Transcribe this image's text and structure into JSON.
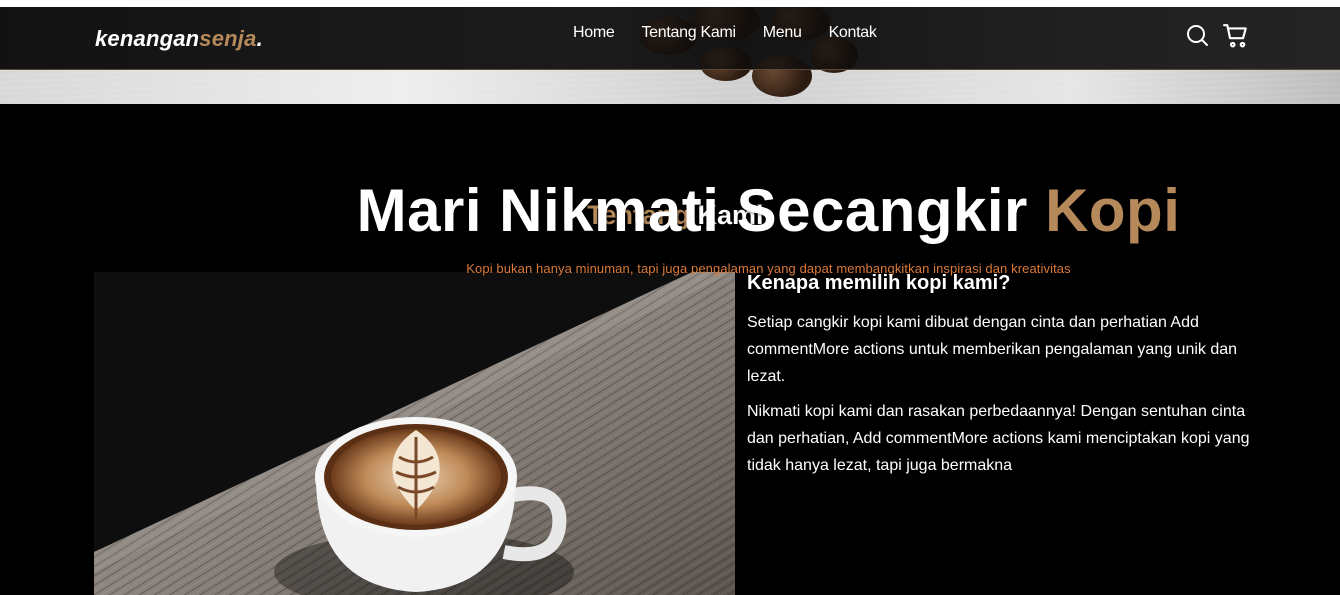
{
  "brand": {
    "part1": "kenangan",
    "part2": "senja",
    "part3": "."
  },
  "nav": {
    "items": [
      {
        "label": "Home"
      },
      {
        "label": "Tentang Kami"
      },
      {
        "label": "Menu"
      },
      {
        "label": "Kontak"
      }
    ],
    "icons": [
      "search-icon",
      "shopping-cart-icon"
    ]
  },
  "hero": {
    "title_main": "Mari Nikmati Secangkir ",
    "title_accent": "Kopi",
    "subtitle": "Kopi bukan hanya minuman, tapi juga pengalaman yang dapat membangkitkan inspirasi dan kreativitas"
  },
  "about": {
    "title_accent": "Tentang",
    "title_rest": " Kami",
    "heading": "Kenapa memilih kopi kami?",
    "paragraph1": "Setiap cangkir kopi kami dibuat dengan cinta dan perhatian Add commentMore actions untuk memberikan pengalaman yang unik dan lezat.",
    "paragraph2": "Nikmati kopi kami dan rasakan perbedaannya! Dengan sentuhan cinta dan perhatian, Add commentMore actions kami menciptakan kopi yang tidak hanya lezat, tapi juga bermakna"
  },
  "colors": {
    "accent": "#b6895b",
    "subtitle": "#d97a3a",
    "background": "#000000"
  }
}
